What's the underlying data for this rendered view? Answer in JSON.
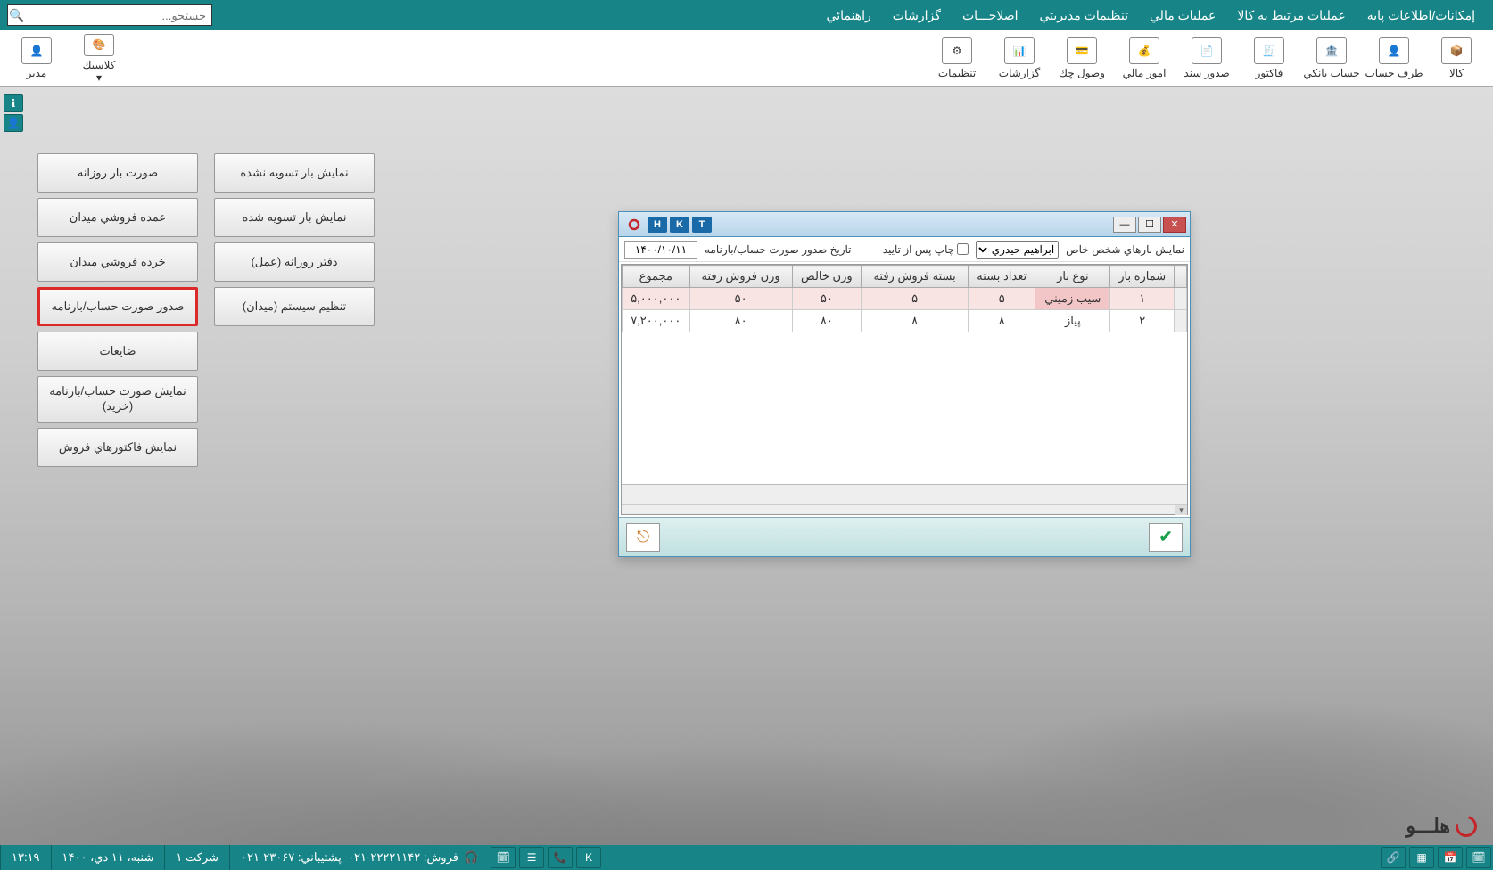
{
  "menu": {
    "items": [
      "إمكانات/اطلاعات پايه",
      "عمليات مرتبط به كالا",
      "عمليات مالي",
      "تنظيمات مديريتي",
      "اصلاحـــات",
      "گزارشات",
      "راهنمائي"
    ],
    "search_placeholder": "جستجو..."
  },
  "ribbon": {
    "tools": [
      {
        "label": "كالا",
        "icon": "box-icon"
      },
      {
        "label": "طرف حساب",
        "icon": "person-icon"
      },
      {
        "label": "حساب بانكي",
        "icon": "bank-icon"
      },
      {
        "label": "فاكتور",
        "icon": "invoice-icon"
      },
      {
        "label": "صدور سند",
        "icon": "doc-icon"
      },
      {
        "label": "امور مالي",
        "icon": "money-icon"
      },
      {
        "label": "وصول چك",
        "icon": "cheque-icon"
      },
      {
        "label": "گزارشات",
        "icon": "report-icon"
      },
      {
        "label": "تنظيمات",
        "icon": "gear-icon"
      }
    ],
    "left_tools": [
      {
        "label": "كلاسيك",
        "icon": "theme-icon"
      },
      {
        "label": "مدير",
        "icon": "user-icon"
      }
    ]
  },
  "panel_col1": [
    "صورت بار روزانه",
    "عمده فروشي ميدان",
    "خرده فروشي ميدان",
    "صدور صورت حساب/بارنامه",
    "ضايعات",
    "نمايش صورت حساب/بارنامه (خريد)",
    "نمايش فاكتورهاي فروش"
  ],
  "panel_col2": [
    "نمايش بار تسويه نشده",
    "نمايش بار تسويه شده",
    "دفتر روزانه (عمل)",
    "تنظيم سيستم (ميدان)"
  ],
  "dialog": {
    "letter_btns": [
      "T",
      "K",
      "H"
    ],
    "label_person": "نمايش بارهاي شخص خاص",
    "person_value": "ابراهيم حيدري",
    "chk_label": "چاپ پس از تاييد",
    "date_label": "تاريخ صدور صورت حساب/بارنامه",
    "date_value": "۱۴۰۰/۱۰/۱۱",
    "columns": [
      "شماره بار",
      "نوع بار",
      "تعداد بسته",
      "بسته فروش رفته",
      "وزن خالص",
      "وزن فروش رفته",
      "مجموع"
    ],
    "rows": [
      {
        "no": "۱",
        "type": "سيب زميني",
        "packs": "۵",
        "sold_packs": "۵",
        "weight": "۵۰",
        "sold_weight": "۵۰",
        "total": "۵,۰۰۰,۰۰۰",
        "selected": true
      },
      {
        "no": "۲",
        "type": "پياز",
        "packs": "۸",
        "sold_packs": "۸",
        "weight": "۸۰",
        "sold_weight": "۸۰",
        "total": "۷,۲۰۰,۰۰۰",
        "selected": false
      }
    ]
  },
  "brand_text": "هلـــو",
  "status": {
    "sales_label": "فروش:",
    "sales_phone": "۰۲۱-۲۲۲۲۱۱۴۲",
    "support_label": "پشتيباني:",
    "support_phone": "۰۲۱-۲۳۰۶۷",
    "company": "شركت ۱",
    "date": "شنبه، ۱۱ دي، ۱۴۰۰",
    "time": "۱۳:۱۹"
  }
}
